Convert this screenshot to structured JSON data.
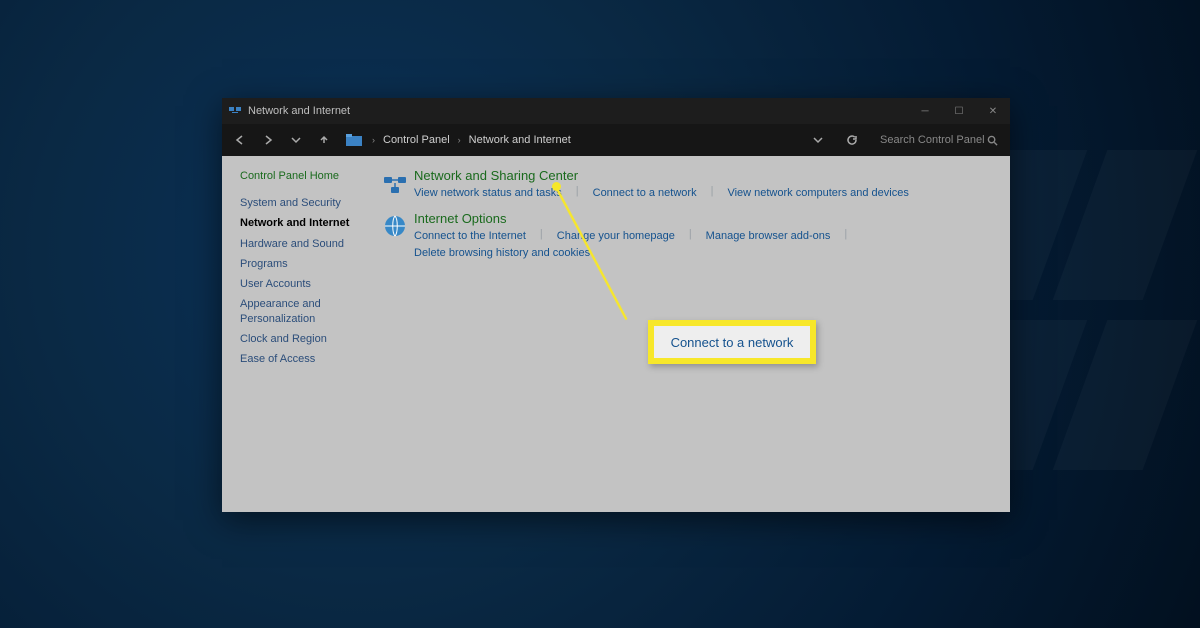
{
  "title": "Network and Internet",
  "breadcrumb": {
    "root": "Control Panel",
    "current": "Network and Internet"
  },
  "search_placeholder": "Search Control Panel",
  "sidebar": {
    "home": "Control Panel Home",
    "items": [
      "System and Security",
      "Network and Internet",
      "Hardware and Sound",
      "Programs",
      "User Accounts",
      "Appearance and Personalization",
      "Clock and Region",
      "Ease of Access"
    ],
    "current_index": 1
  },
  "sections": [
    {
      "title": "Network and Sharing Center",
      "links": [
        "View network status and tasks",
        "Connect to a network",
        "View network computers and devices"
      ]
    },
    {
      "title": "Internet Options",
      "links": [
        "Connect to the Internet",
        "Change your homepage",
        "Manage browser add-ons",
        "Delete browsing history and cookies"
      ]
    }
  ],
  "callout": {
    "label": "Connect to a network"
  }
}
